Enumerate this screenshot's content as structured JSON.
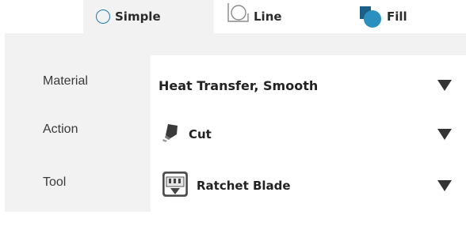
{
  "tabs": {
    "simple": {
      "label": "Simple",
      "icon": "circle-icon"
    },
    "line": {
      "label": "Line",
      "icon": "line-icon"
    },
    "fill": {
      "label": "Fill",
      "icon": "fill-icon"
    }
  },
  "settings": {
    "material": {
      "label": "Material",
      "value": "Heat Transfer, Smooth"
    },
    "action": {
      "label": "Action",
      "value": "Cut",
      "icon": "cut-blade-icon"
    },
    "tool": {
      "label": "Tool",
      "value": "Ratchet Blade",
      "icon": "ratchet-blade-icon"
    }
  },
  "colors": {
    "accent": "#1a7ab8",
    "fill_icon": "#2b8fbf",
    "panel_bg": "#f2f2f2"
  }
}
